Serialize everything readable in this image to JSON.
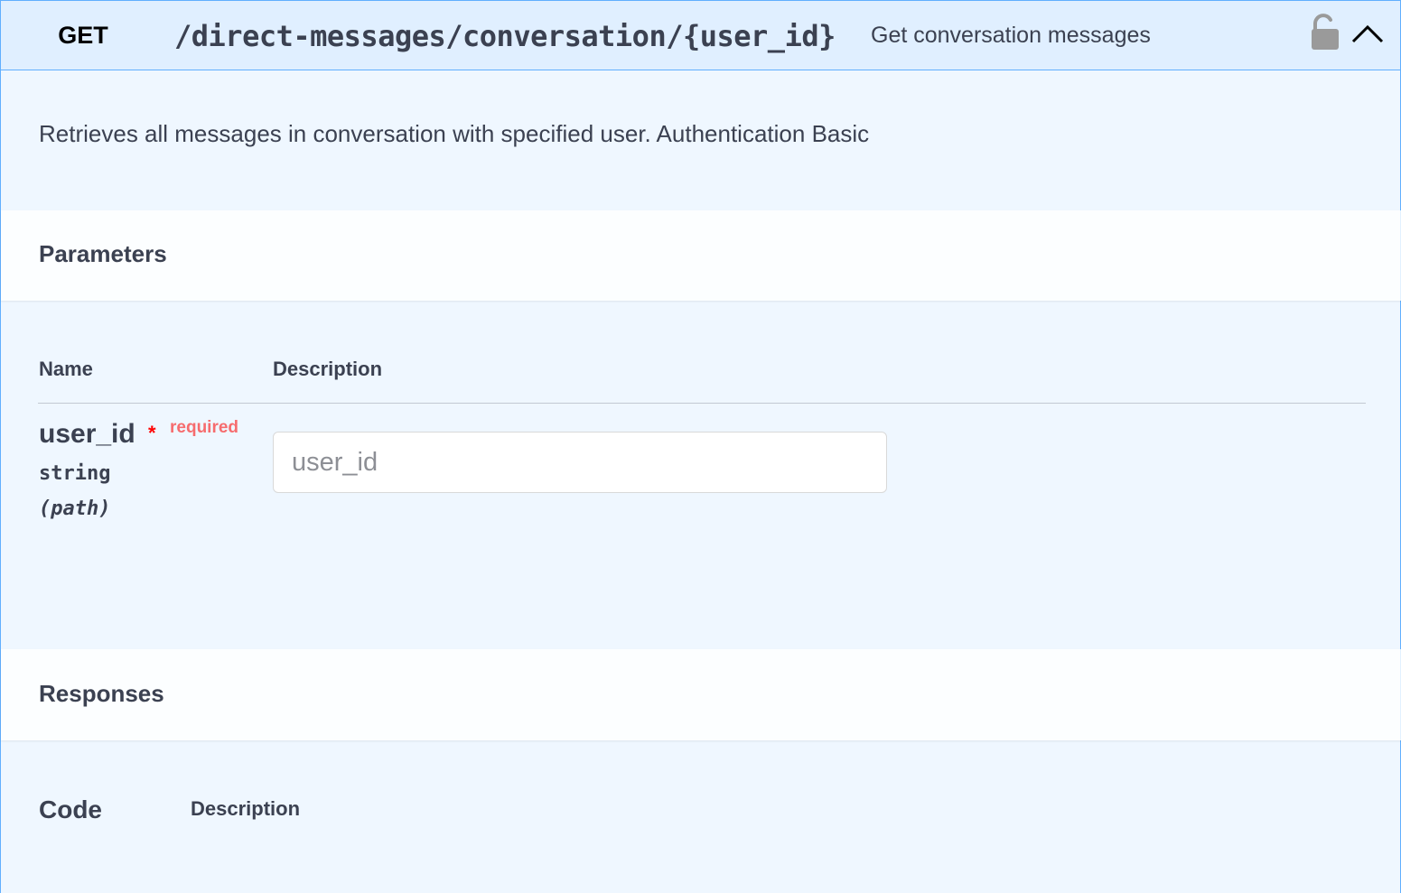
{
  "operation": {
    "method": "GET",
    "path": "/direct-messages/conversation/{user_id}",
    "summary": "Get conversation messages",
    "description": "Retrieves all messages in conversation with specified user. Authentication Basic"
  },
  "parameters": {
    "title": "Parameters",
    "columns": {
      "name": "Name",
      "description": "Description"
    },
    "items": [
      {
        "name": "user_id",
        "required_star": "*",
        "required_label": "required",
        "type": "string",
        "in": "(path)",
        "placeholder": "user_id",
        "value": ""
      }
    ]
  },
  "responses": {
    "title": "Responses",
    "columns": {
      "code": "Code",
      "description": "Description"
    }
  },
  "icons": {
    "lock": "unlocked-padlock-icon",
    "collapse": "chevron-up-icon"
  },
  "colors": {
    "get_accent": "#61affe",
    "required": "#f93e3e",
    "text": "#3b4151"
  }
}
